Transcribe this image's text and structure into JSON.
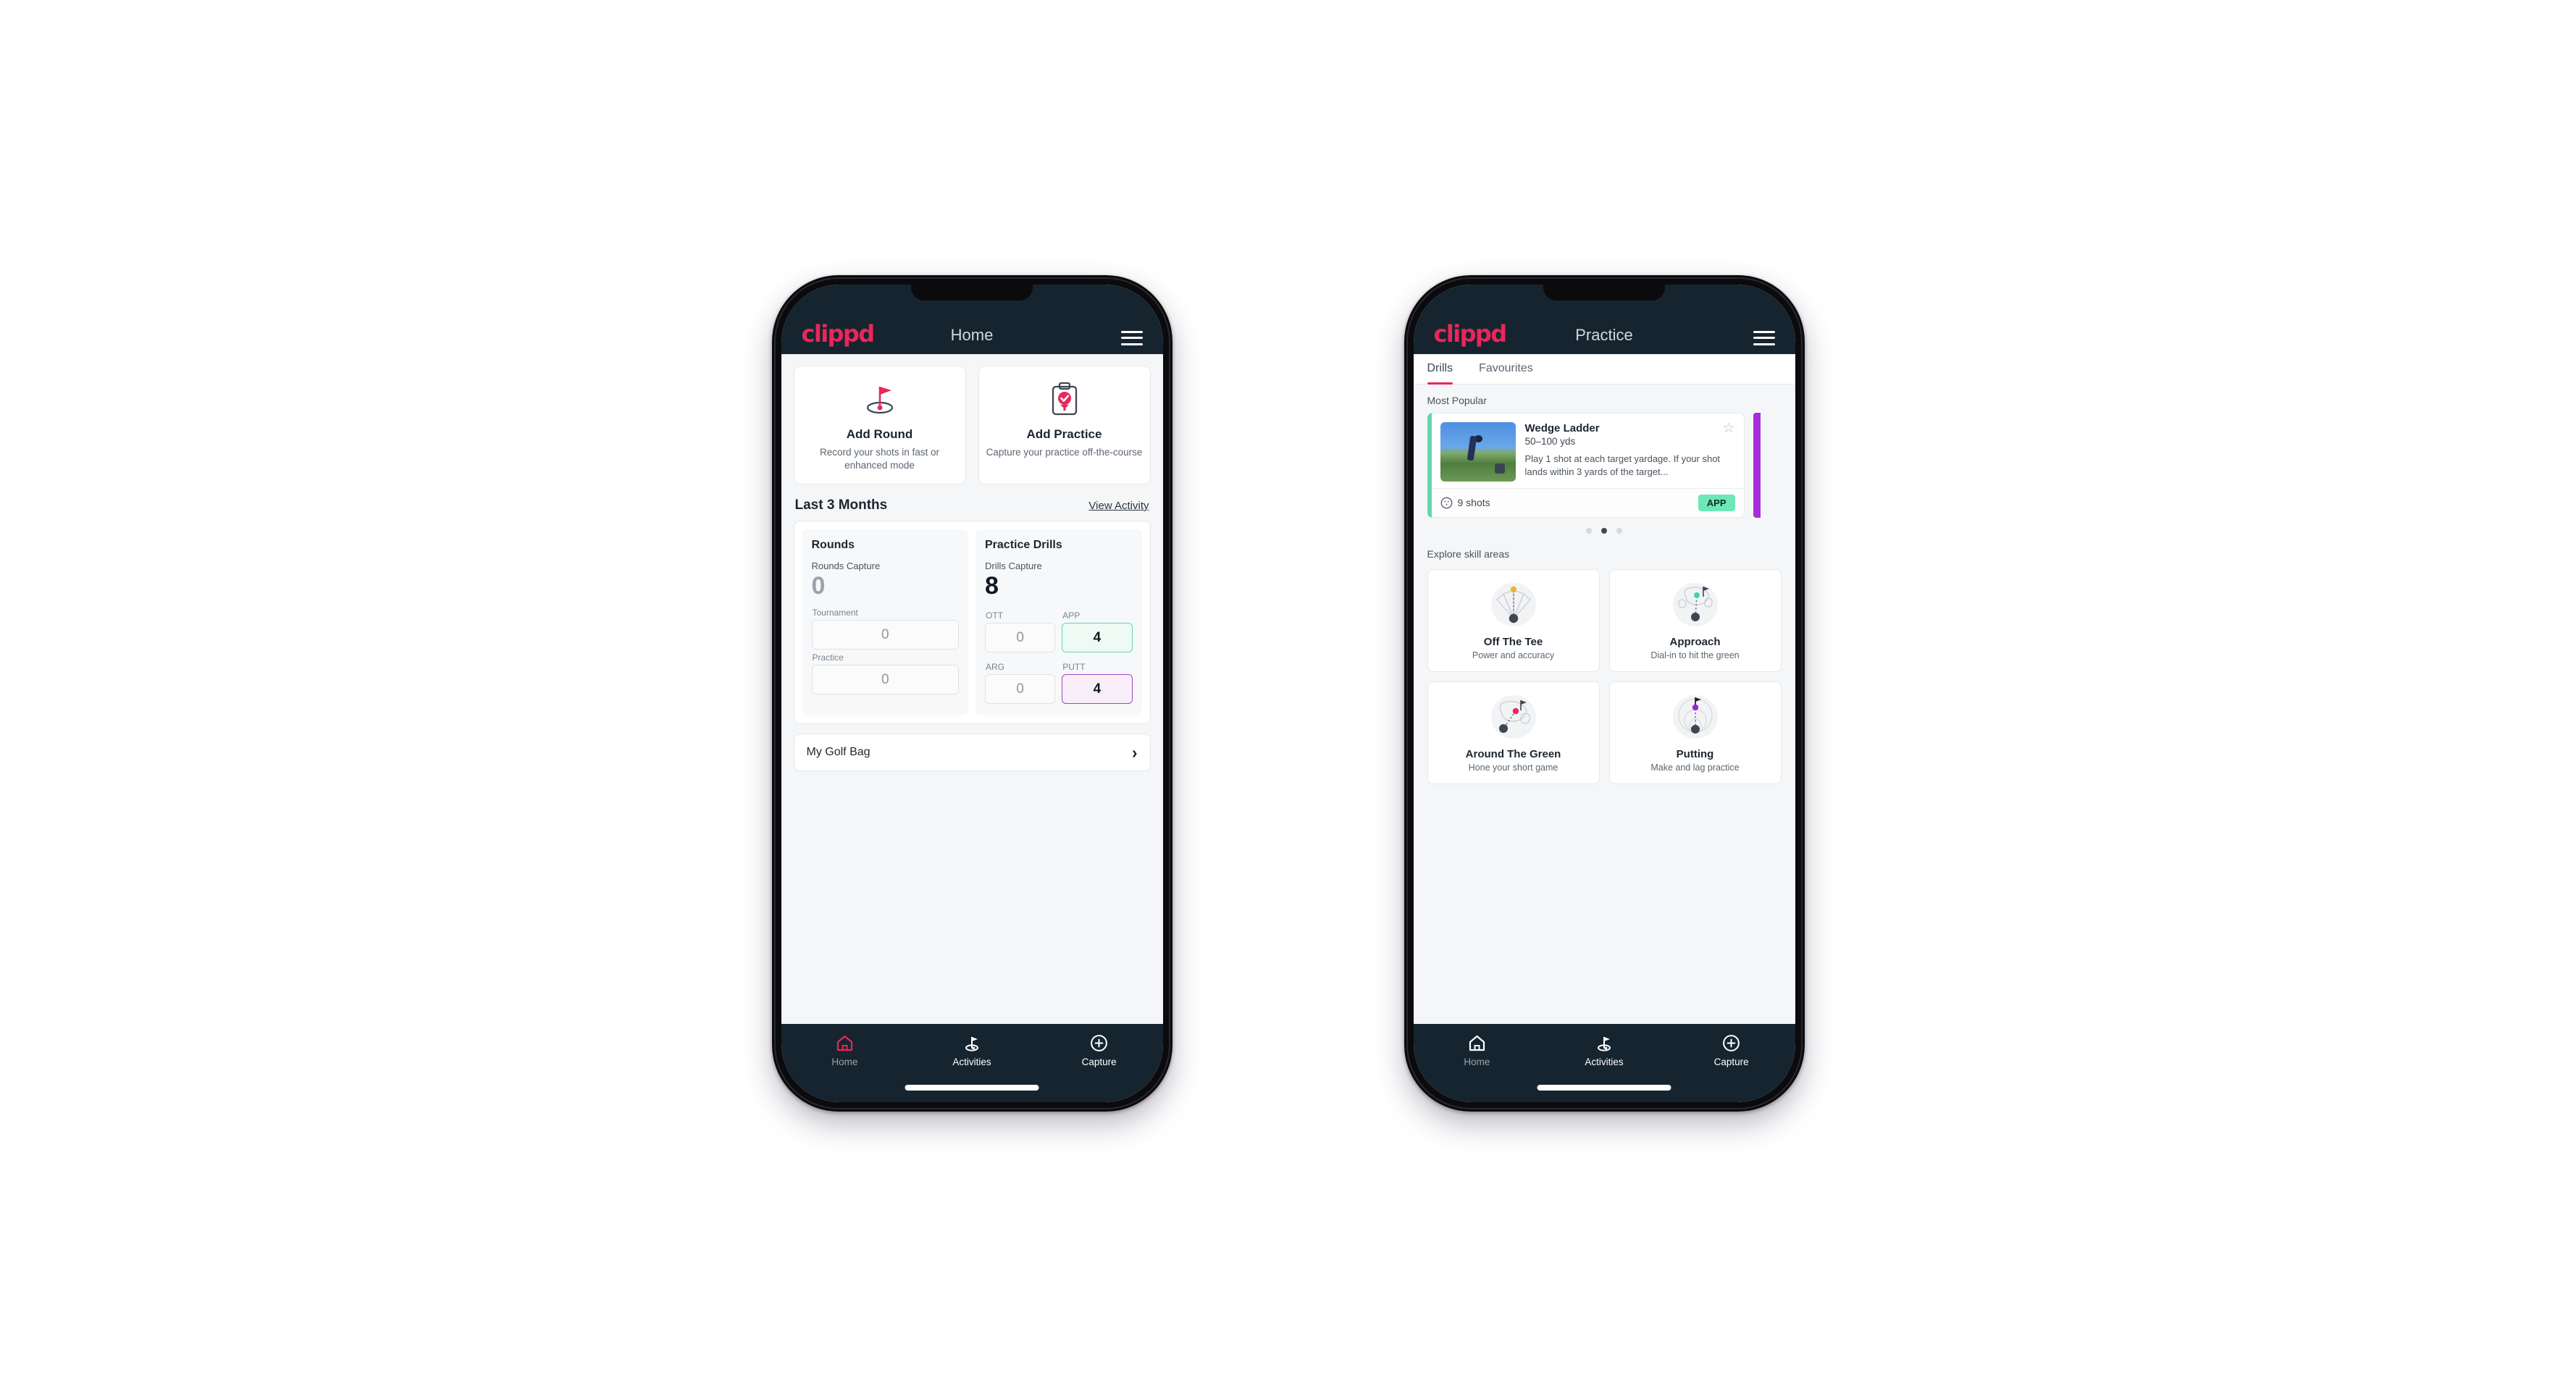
{
  "theme": {
    "appbar_bg": "#16242f",
    "brand_pink": "#e8275a",
    "mint": "#6ee7b7",
    "purple": "#a62ddb",
    "page_bg": "#f5f6f8"
  },
  "phone_home": {
    "appbar": {
      "logo": "clippd",
      "title": "Home",
      "menu_icon": "hamburger-icon"
    },
    "quick_actions": [
      {
        "icon": "golf-flag-hole-icon",
        "title": "Add Round",
        "subtitle": "Record your shots in fast or enhanced mode"
      },
      {
        "icon": "clipboard-check-icon",
        "title": "Add Practice",
        "subtitle": "Capture your practice off-the-course"
      }
    ],
    "section": {
      "title": "Last 3 Months",
      "link": "View Activity"
    },
    "stats": {
      "rounds": {
        "heading": "Rounds",
        "capture_label": "Rounds Capture",
        "capture_value": "0",
        "fields": [
          {
            "label": "Tournament",
            "value": "0",
            "style": "plain"
          },
          {
            "label": "Practice",
            "value": "0",
            "style": "plain"
          }
        ]
      },
      "drills": {
        "heading": "Practice Drills",
        "capture_label": "Drills Capture",
        "capture_value": "8",
        "fields": [
          {
            "label": "OTT",
            "value": "0",
            "style": "plain"
          },
          {
            "label": "APP",
            "value": "4",
            "style": "app"
          },
          {
            "label": "ARG",
            "value": "0",
            "style": "plain"
          },
          {
            "label": "PUTT",
            "value": "4",
            "style": "putt"
          }
        ]
      }
    },
    "golf_bag": {
      "label": "My Golf Bag",
      "chevron": "chevron-right-icon"
    },
    "bottom_nav": [
      {
        "label": "Home",
        "icon": "home-icon",
        "active": true
      },
      {
        "label": "Activities",
        "icon": "golf-flag-icon",
        "active": false
      },
      {
        "label": "Capture",
        "icon": "plus-circle-icon",
        "active": false
      }
    ]
  },
  "phone_practice": {
    "appbar": {
      "logo": "clippd",
      "title": "Practice",
      "menu_icon": "hamburger-icon"
    },
    "tabs": [
      {
        "label": "Drills",
        "active": true
      },
      {
        "label": "Favourites",
        "active": false
      }
    ],
    "most_popular_label": "Most Popular",
    "drill_card": {
      "name": "Wedge Ladder",
      "range": "50–100 yds",
      "description": "Play 1 shot at each target yardage. If your shot lands within 3 yards of the target...",
      "shots": "9 shots",
      "shots_icon": "golf-ball-icon",
      "badge": "APP",
      "favourite_icon": "star-outline-icon",
      "accent": "#63d7ae"
    },
    "carousel_dots": {
      "count": 3,
      "active_index": 1
    },
    "skill_label": "Explore skill areas",
    "skill_areas": [
      {
        "title": "Off The Tee",
        "subtitle": "Power and accuracy",
        "art": "tee-fan-icon",
        "dot": "#f0b429"
      },
      {
        "title": "Approach",
        "subtitle": "Dial-in to hit the green",
        "art": "green-approach-icon",
        "dot": "#3fd6a4"
      },
      {
        "title": "Around The Green",
        "subtitle": "Hone your short game",
        "art": "chip-green-icon",
        "dot": "#e8275a"
      },
      {
        "title": "Putting",
        "subtitle": "Make and lag practice",
        "art": "putting-rings-icon",
        "dot": "#9b27d0"
      }
    ],
    "bottom_nav": [
      {
        "label": "Home",
        "icon": "home-icon",
        "active": false
      },
      {
        "label": "Activities",
        "icon": "golf-flag-icon",
        "active": true
      },
      {
        "label": "Capture",
        "icon": "plus-circle-icon",
        "active": false
      }
    ]
  }
}
